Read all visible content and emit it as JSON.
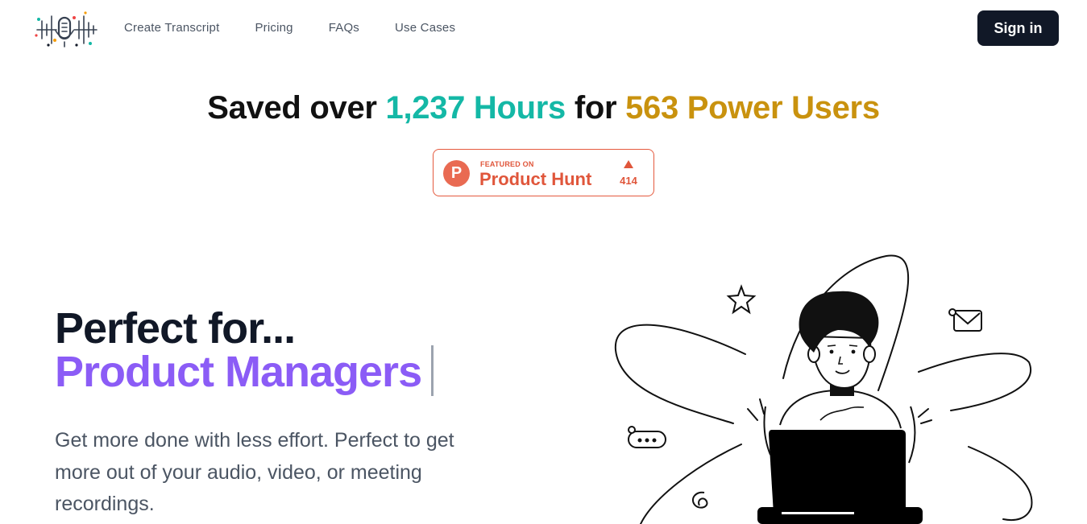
{
  "header": {
    "logo_icon": "waveform-microphone-logo",
    "nav": [
      {
        "label": "Create Transcript"
      },
      {
        "label": "Pricing"
      },
      {
        "label": "FAQs"
      },
      {
        "label": "Use Cases"
      }
    ],
    "signin_label": "Sign in"
  },
  "stats": {
    "prefix": "Saved over",
    "hours": "1,237 Hours",
    "middle": "for",
    "users": "563 Power Users",
    "hours_color": "#14b8a6",
    "users_color": "#c9920e"
  },
  "product_hunt": {
    "logo_letter": "P",
    "featured": "FEATURED ON",
    "name": "Product Hunt",
    "upvotes": "414",
    "color": "#e0563b"
  },
  "hero": {
    "title": "Perfect for...",
    "role": "Product Managers",
    "role_color": "#8b5cf6",
    "description": "Get more done with less effort. Perfect to get more out of your audio, video, or meeting recordings."
  },
  "illustration": {
    "icons": [
      "person-with-laptop-illustration",
      "star-icon",
      "mail-icon",
      "chat-bubble-icon",
      "spiral-icon"
    ]
  },
  "colors": {
    "primary_dark": "#111827",
    "accent_purple": "#8b5cf6"
  }
}
